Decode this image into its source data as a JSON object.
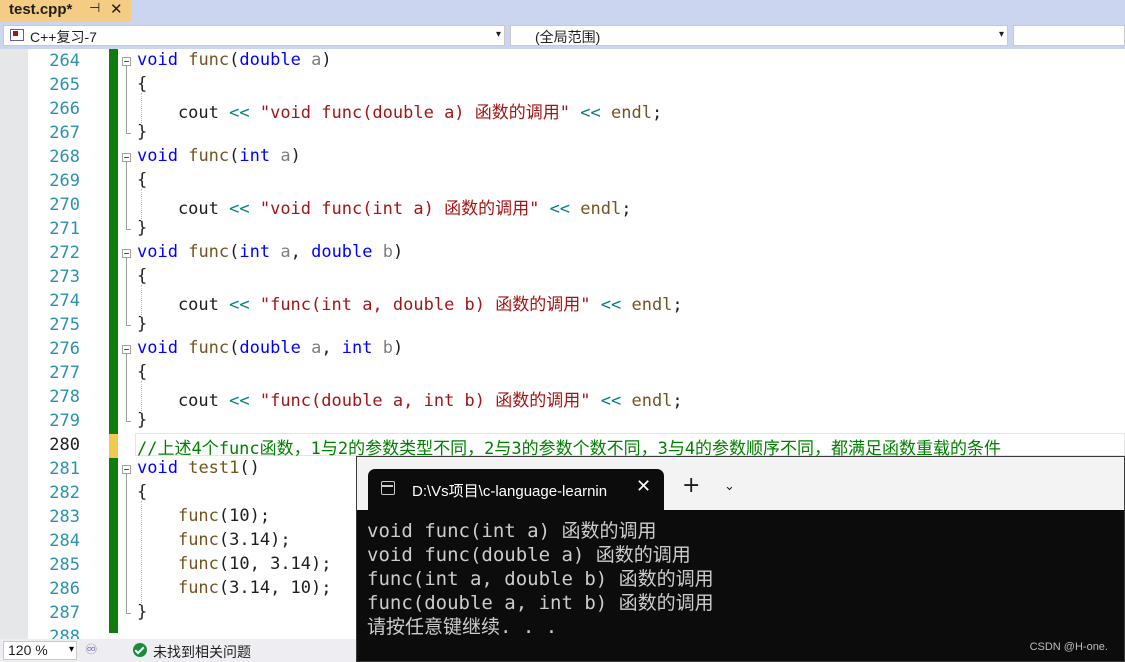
{
  "tab": {
    "title": "test.cpp*",
    "pin": "⊣",
    "close": "✕"
  },
  "nav": {
    "project": "C++复习-7",
    "scope": "(全局范围)",
    "arrow": "▾"
  },
  "editor": {
    "lines": [
      {
        "num": "264",
        "tokens": [
          [
            "kw",
            "void"
          ],
          [
            "",
            " "
          ],
          [
            "fn",
            "func"
          ],
          [
            "",
            "("
          ],
          [
            "kw",
            "double"
          ],
          [
            "",
            ""
          ],
          [
            "par",
            " a"
          ],
          [
            "",
            ")"
          ]
        ]
      },
      {
        "num": "265",
        "tokens": [
          [
            "",
            "{"
          ]
        ]
      },
      {
        "num": "266",
        "tokens": [
          [
            "",
            "    cout "
          ],
          [
            "op",
            "<<"
          ],
          [
            "",
            ""
          ],
          [
            "str",
            " \"void func(double a) 函数的调用\""
          ],
          [
            "",
            " "
          ],
          [
            "op",
            "<<"
          ],
          [
            "",
            " "
          ],
          [
            "fn",
            "endl"
          ],
          [
            "",
            ";"
          ]
        ]
      },
      {
        "num": "267",
        "tokens": [
          [
            "",
            "}"
          ]
        ]
      },
      {
        "num": "268",
        "tokens": [
          [
            "kw",
            "void"
          ],
          [
            "",
            " "
          ],
          [
            "fn",
            "func"
          ],
          [
            "",
            "("
          ],
          [
            "kw",
            "int"
          ],
          [
            "par",
            " a"
          ],
          [
            "",
            ")"
          ]
        ]
      },
      {
        "num": "269",
        "tokens": [
          [
            "",
            "{"
          ]
        ]
      },
      {
        "num": "270",
        "tokens": [
          [
            "",
            "    cout "
          ],
          [
            "op",
            "<<"
          ],
          [
            "str",
            " \"void func(int a) 函数的调用\""
          ],
          [
            "",
            " "
          ],
          [
            "op",
            "<<"
          ],
          [
            "",
            " "
          ],
          [
            "fn",
            "endl"
          ],
          [
            "",
            ";"
          ]
        ]
      },
      {
        "num": "271",
        "tokens": [
          [
            "",
            "}"
          ]
        ]
      },
      {
        "num": "272",
        "tokens": [
          [
            "kw",
            "void"
          ],
          [
            "",
            " "
          ],
          [
            "fn",
            "func"
          ],
          [
            "",
            "("
          ],
          [
            "kw",
            "int"
          ],
          [
            "par",
            " a"
          ],
          [
            "",
            ", "
          ],
          [
            "kw",
            "double"
          ],
          [
            "par",
            " b"
          ],
          [
            "",
            ")"
          ]
        ]
      },
      {
        "num": "273",
        "tokens": [
          [
            "",
            "{"
          ]
        ]
      },
      {
        "num": "274",
        "tokens": [
          [
            "",
            "    cout "
          ],
          [
            "op",
            "<<"
          ],
          [
            "str",
            " \"func(int a, double b) 函数的调用\""
          ],
          [
            "",
            " "
          ],
          [
            "op",
            "<<"
          ],
          [
            "",
            " "
          ],
          [
            "fn",
            "endl"
          ],
          [
            "",
            ";"
          ]
        ]
      },
      {
        "num": "275",
        "tokens": [
          [
            "",
            "}"
          ]
        ]
      },
      {
        "num": "276",
        "tokens": [
          [
            "kw",
            "void"
          ],
          [
            "",
            " "
          ],
          [
            "fn",
            "func"
          ],
          [
            "",
            "("
          ],
          [
            "kw",
            "double"
          ],
          [
            "par",
            " a"
          ],
          [
            "",
            ", "
          ],
          [
            "kw",
            "int"
          ],
          [
            "par",
            " b"
          ],
          [
            "",
            ")"
          ]
        ]
      },
      {
        "num": "277",
        "tokens": [
          [
            "",
            "{"
          ]
        ]
      },
      {
        "num": "278",
        "tokens": [
          [
            "",
            "    cout "
          ],
          [
            "op",
            "<<"
          ],
          [
            "str",
            " \"func(double a, int b) 函数的调用\""
          ],
          [
            "",
            " "
          ],
          [
            "op",
            "<<"
          ],
          [
            "",
            " "
          ],
          [
            "fn",
            "endl"
          ],
          [
            "",
            ";"
          ]
        ]
      },
      {
        "num": "279",
        "tokens": [
          [
            "",
            "}"
          ]
        ]
      },
      {
        "num": "280",
        "tokens": [
          [
            "cmt",
            "//上述4个func函数，1与2的参数类型不同，2与3的参数个数不同，3与4的参数顺序不同，都满足函数重载的条件"
          ]
        ]
      },
      {
        "num": "281",
        "tokens": [
          [
            "kw",
            "void"
          ],
          [
            "",
            " "
          ],
          [
            "fn",
            "test1"
          ],
          [
            "",
            "()"
          ]
        ]
      },
      {
        "num": "282",
        "tokens": [
          [
            "",
            "{"
          ]
        ]
      },
      {
        "num": "283",
        "tokens": [
          [
            "",
            "    "
          ],
          [
            "fn",
            "func"
          ],
          [
            "",
            "(10);"
          ]
        ]
      },
      {
        "num": "284",
        "tokens": [
          [
            "",
            "    "
          ],
          [
            "fn",
            "func"
          ],
          [
            "",
            "(3.14);"
          ]
        ]
      },
      {
        "num": "285",
        "tokens": [
          [
            "",
            "    "
          ],
          [
            "fn",
            "func"
          ],
          [
            "",
            "(10, 3.14);"
          ]
        ]
      },
      {
        "num": "286",
        "tokens": [
          [
            "",
            "    "
          ],
          [
            "fn",
            "func"
          ],
          [
            "",
            "(3.14, 10);"
          ]
        ]
      },
      {
        "num": "287",
        "tokens": [
          [
            "",
            "}"
          ]
        ]
      },
      {
        "num": "288",
        "tokens": []
      }
    ]
  },
  "status": {
    "zoom": "120 %",
    "issues": "未找到相关问题"
  },
  "terminal": {
    "title": "D:\\Vs项目\\c-language-learnin",
    "close": "✕",
    "new_tab": "+",
    "dropdown": "⌄",
    "output": [
      "void func(int a) 函数的调用",
      "void func(double a) 函数的调用",
      "func(int a, double b) 函数的调用",
      "func(double a, int b) 函数的调用",
      "请按任意键继续. . ."
    ]
  },
  "watermark": "CSDN @H-one."
}
